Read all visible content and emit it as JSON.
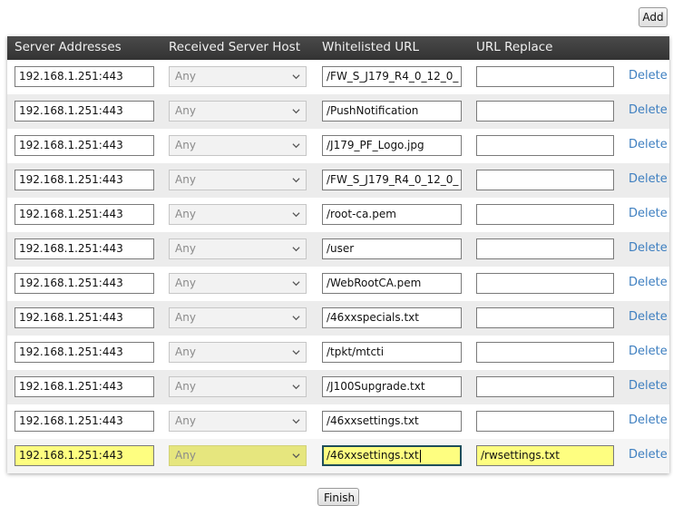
{
  "toolbar": {
    "add_label": "Add"
  },
  "table": {
    "headers": [
      "Server Addresses",
      "Received Server Host",
      "Whitelisted URL",
      "URL Replace"
    ],
    "delete_label": "Delete",
    "rows": [
      {
        "server": "192.168.1.251:443",
        "host": "Any",
        "url": "/FW_S_J179_R4_0_12_0_",
        "replace": ""
      },
      {
        "server": "192.168.1.251:443",
        "host": "Any",
        "url": "/PushNotification",
        "replace": ""
      },
      {
        "server": "192.168.1.251:443",
        "host": "Any",
        "url": "/J179_PF_Logo.jpg",
        "replace": ""
      },
      {
        "server": "192.168.1.251:443",
        "host": "Any",
        "url": "/FW_S_J179_R4_0_12_0_",
        "replace": ""
      },
      {
        "server": "192.168.1.251:443",
        "host": "Any",
        "url": "/root-ca.pem",
        "replace": ""
      },
      {
        "server": "192.168.1.251:443",
        "host": "Any",
        "url": "/user",
        "replace": ""
      },
      {
        "server": "192.168.1.251:443",
        "host": "Any",
        "url": "/WebRootCA.pem",
        "replace": ""
      },
      {
        "server": "192.168.1.251:443",
        "host": "Any",
        "url": "/46xxspecials.txt",
        "replace": ""
      },
      {
        "server": "192.168.1.251:443",
        "host": "Any",
        "url": "/tpkt/mtcti",
        "replace": ""
      },
      {
        "server": "192.168.1.251:443",
        "host": "Any",
        "url": "/J100Supgrade.txt",
        "replace": ""
      },
      {
        "server": "192.168.1.251:443",
        "host": "Any",
        "url": "/46xxsettings.txt",
        "replace": ""
      },
      {
        "server": "192.168.1.251:443",
        "host": "Any",
        "url": "/46xxsettings.txt",
        "replace": "/rwsettings.txt"
      }
    ]
  },
  "footer": {
    "finish_label": "Finish"
  },
  "colors": {
    "header_bg": "#3a3a3a",
    "highlight": "#fefe80",
    "link": "#3e7fc0"
  },
  "icons": {
    "select_arrow": "chevron-down-icon"
  }
}
